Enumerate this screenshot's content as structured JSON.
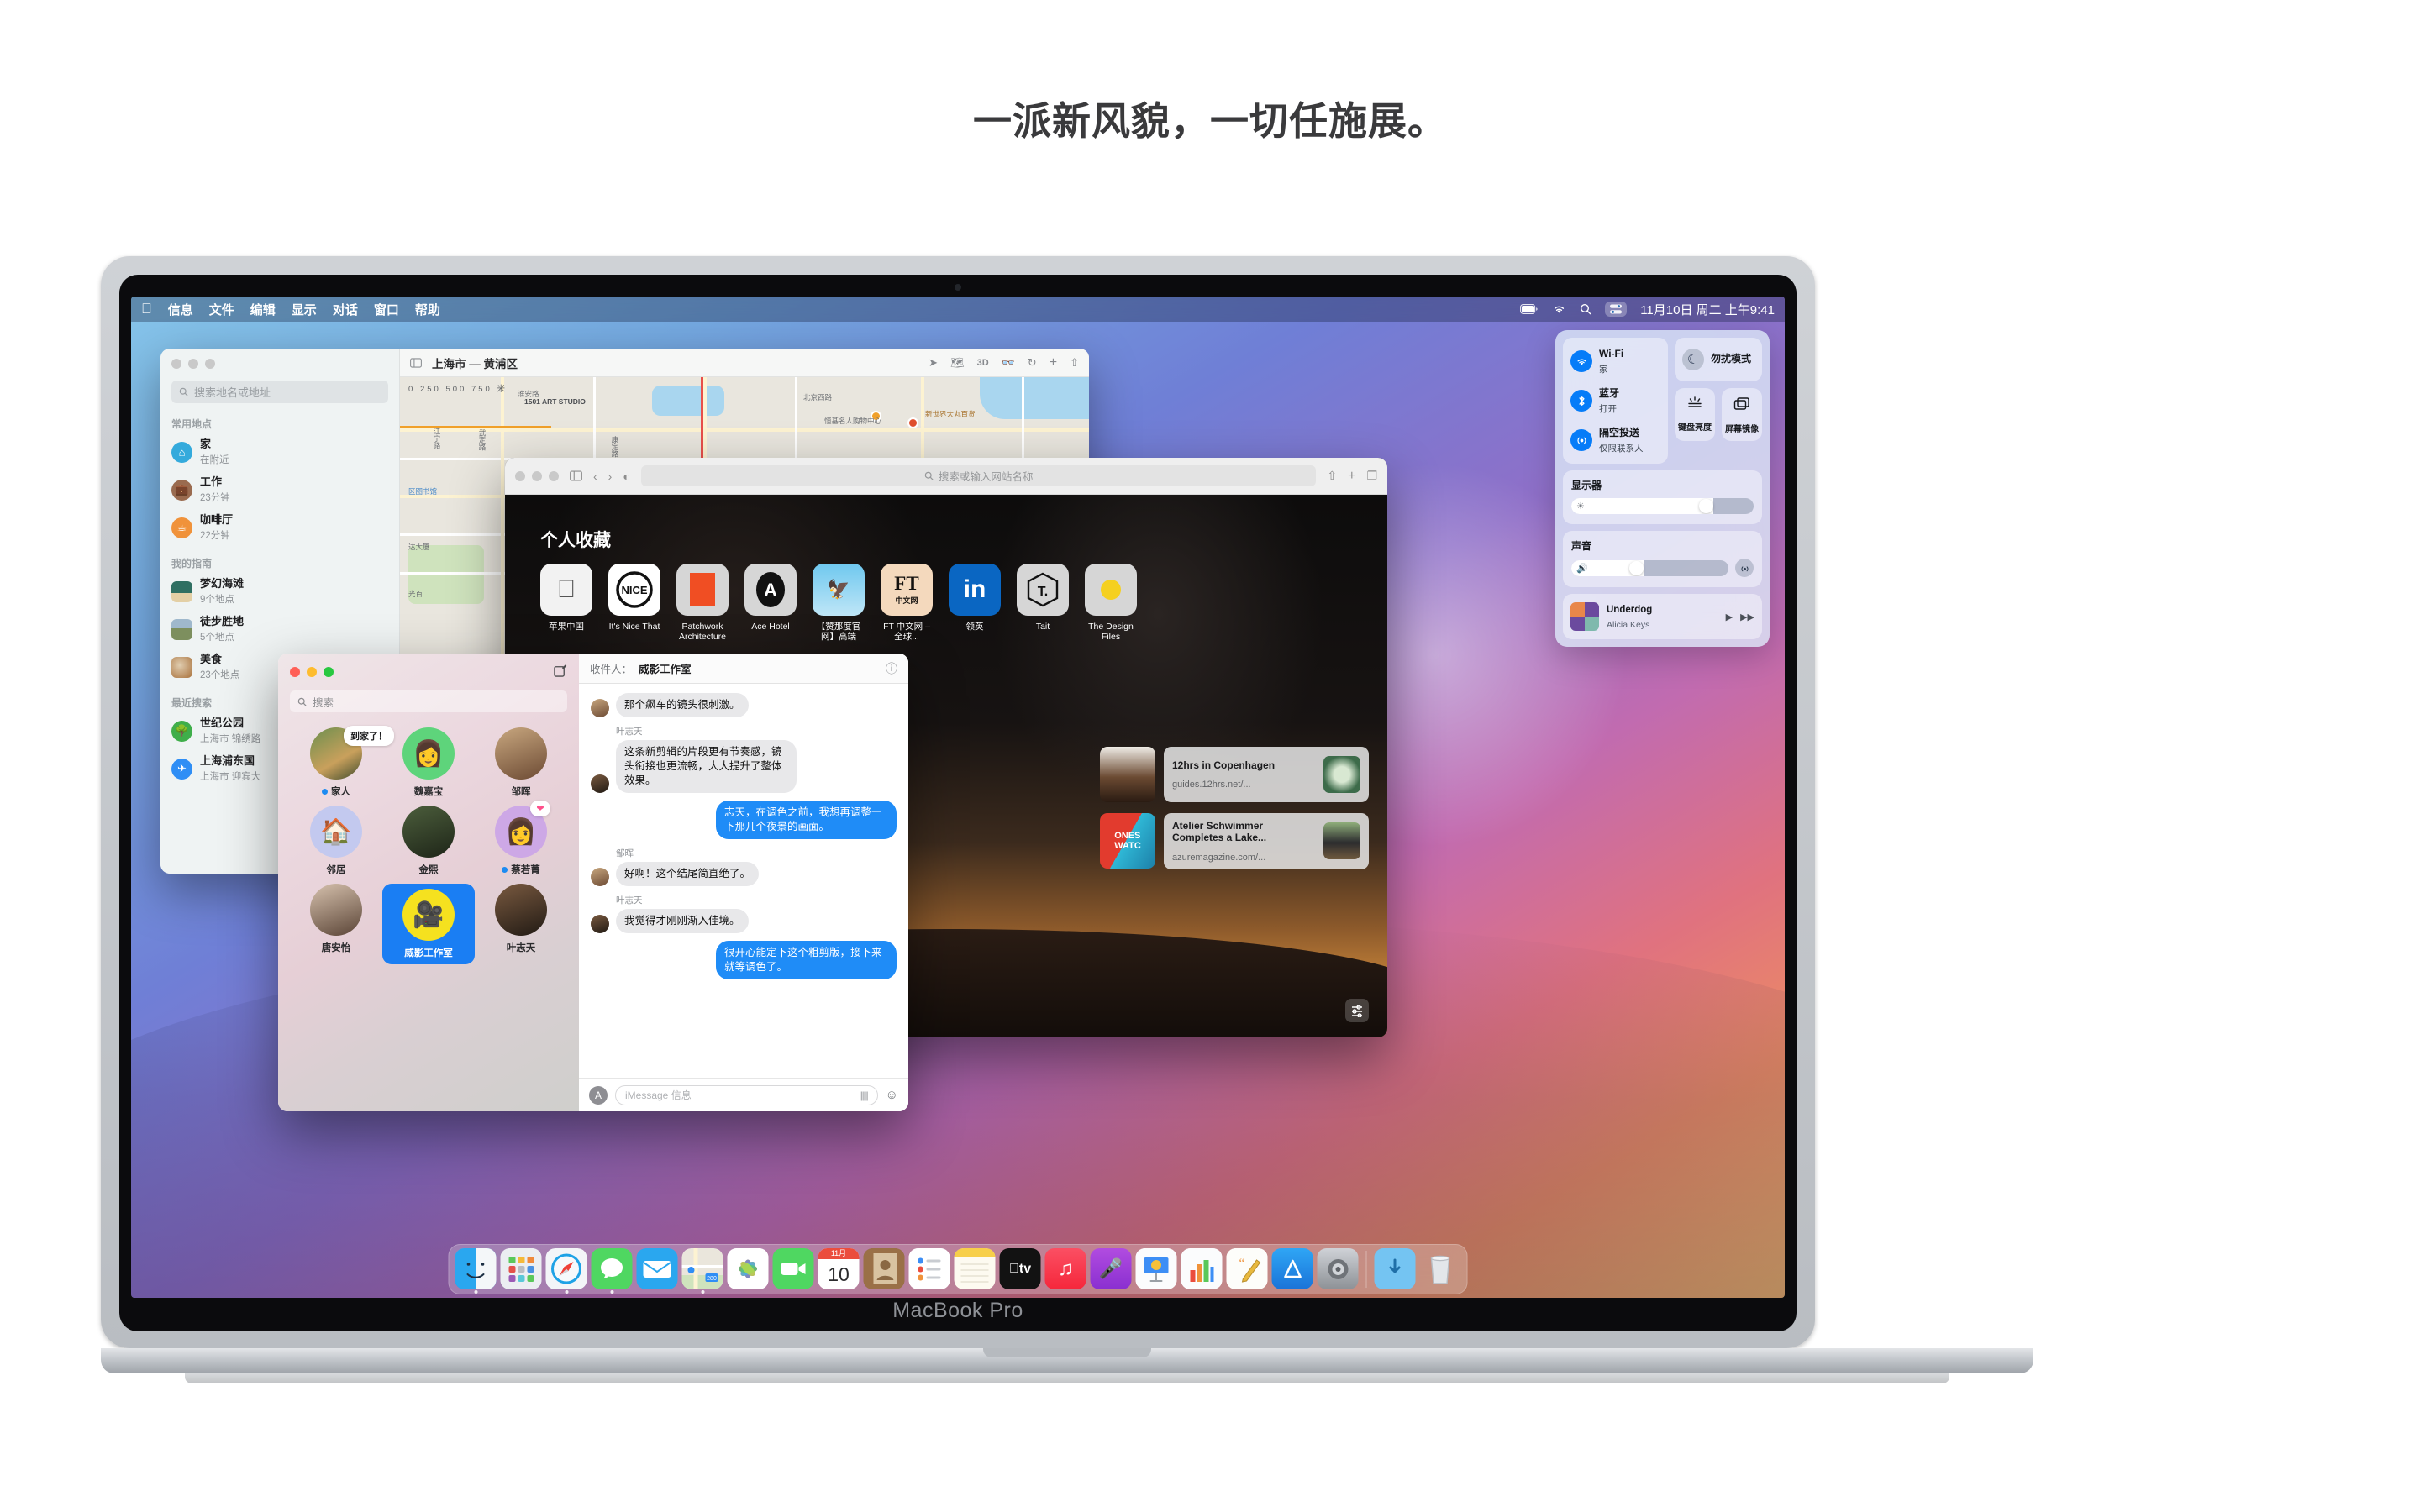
{
  "headline": "一派新风貌，一切任施展。",
  "device": {
    "name": "MacBook Pro"
  },
  "menubar": {
    "apple": "",
    "items": [
      "信息",
      "文件",
      "编辑",
      "显示",
      "对话",
      "窗口",
      "帮助"
    ],
    "clock": "11月10日 周二 上午9:41",
    "status_icons": [
      "battery-icon",
      "wifi-icon",
      "search-icon",
      "control-center-icon"
    ]
  },
  "maps": {
    "search_placeholder": "搜索地名或地址",
    "title": "上海市 — 黄浦区",
    "toolbar_icons": [
      "location-arrow-icon",
      "map-layers-icon",
      "3d-icon",
      "binoculars-icon",
      "share-route-icon",
      "zoom-in-icon",
      "share-icon"
    ],
    "sections": [
      {
        "title": "常用地点",
        "items": [
          {
            "name": "家",
            "detail": "在附近",
            "icon": "home-icon",
            "color": "#34aadc"
          },
          {
            "name": "工作",
            "detail": "23分钟",
            "icon": "briefcase-icon",
            "color": "#9a6b4f"
          },
          {
            "name": "咖啡厅",
            "detail": "22分钟",
            "icon": "coffee-icon",
            "color": "#f0923a"
          }
        ]
      },
      {
        "title": "我的指南",
        "items": [
          {
            "name": "梦幻海滩",
            "detail": "9个地点",
            "icon": "beach-thumb",
            "color": "#2f6f62"
          },
          {
            "name": "徒步胜地",
            "detail": "5个地点",
            "icon": "hiking-thumb",
            "color": "#6b8d5a"
          },
          {
            "name": "美食",
            "detail": "23个地点",
            "icon": "food-thumb",
            "color": "#b4732f"
          }
        ]
      },
      {
        "title": "最近搜索",
        "items": [
          {
            "name": "世纪公园",
            "detail": "上海市 锦绣路",
            "icon": "park-icon",
            "color": "#3fae4a"
          },
          {
            "name": "上海浦东国",
            "detail": "上海市 迎宾大",
            "icon": "airport-icon",
            "color": "#2f8ef5"
          }
        ]
      }
    ],
    "scale_labels": [
      "0",
      "250",
      "500",
      "750",
      "米"
    ],
    "map_labels": [
      "1501 ART STUDIO",
      "淮安路",
      "北京西路",
      "恒基名人购物中心",
      "新世界大丸百货",
      "区图书馆",
      "达大厦",
      "光百",
      "康定路",
      "武定路",
      "江宁路"
    ]
  },
  "safari": {
    "url_placeholder": "搜索或输入网站名称",
    "toolbar_icons": [
      "sidebar-icon",
      "back-icon",
      "forward-icon",
      "privacy-report-icon",
      "share-icon",
      "new-tab-icon",
      "tab-overview-icon"
    ],
    "favorites_title": "个人收藏",
    "favorites": [
      {
        "label": "苹果中国",
        "icon": "apple-logo"
      },
      {
        "label": "It's Nice That",
        "icon": "nice-that-logo"
      },
      {
        "label": "Patchwork Architecture",
        "icon": "patchwork-logo"
      },
      {
        "label": "Ace Hotel",
        "icon": "ace-hotel-logo"
      },
      {
        "label": "【赞那度官网】高端",
        "icon": "zanadu-logo"
      },
      {
        "label": "FT 中文网 – 全球...",
        "icon": "ft-logo"
      },
      {
        "label": "领英",
        "icon": "linkedin-logo"
      },
      {
        "label": "Tait",
        "icon": "tait-logo"
      },
      {
        "label": "The Design Files",
        "icon": "design-files-logo"
      }
    ],
    "reading_list": [
      {
        "title": "12hrs in Copenhagen",
        "url": "guides.12hrs.net/..."
      },
      {
        "title": "Atelier Schwimmer Completes a Lake...",
        "url": "azuremagazine.com/..."
      }
    ]
  },
  "messages": {
    "search_placeholder": "搜索",
    "compose_icon": "compose-icon",
    "contacts": [
      {
        "name": "家人",
        "unread": true,
        "bubble": "到家了！",
        "avatar": "family-photo"
      },
      {
        "name": "魏嘉宝",
        "unread": false,
        "avatar": "memoji-green"
      },
      {
        "name": "邹晖",
        "unread": false,
        "avatar": "woman-photo"
      },
      {
        "name": "邻居",
        "unread": false,
        "avatar": "house-emoji"
      },
      {
        "name": "金熙",
        "unread": false,
        "avatar": "man-glasses-photo"
      },
      {
        "name": "蔡若菁",
        "unread": true,
        "avatar": "memoji-beret",
        "reaction": "♥"
      },
      {
        "name": "唐安怡",
        "unread": false,
        "avatar": "woman-bob-photo"
      },
      {
        "name": "威影工作室",
        "selected": true,
        "avatar": "projector-emoji"
      },
      {
        "name": "叶志天",
        "unread": false,
        "avatar": "man-photo"
      }
    ],
    "recipient_label": "收件人：",
    "recipient": "威影工作室",
    "thread": [
      {
        "from": "them",
        "sender": "",
        "text": "那个飙车的镜头很刺激。",
        "avatar": "woman-photo"
      },
      {
        "from": "them",
        "sender": "叶志天",
        "text": "这条新剪辑的片段更有节奏感，镜头衔接也更流畅，大大提升了整体效果。",
        "avatar": "man-photo"
      },
      {
        "from": "me",
        "sender": "",
        "text": "志天，在调色之前，我想再调整一下那几个夜景的画面。",
        "avatar": ""
      },
      {
        "from": "them",
        "sender": "邹晖",
        "text": "好啊！这个结尾简直绝了。",
        "avatar": "woman-photo"
      },
      {
        "from": "them",
        "sender": "叶志天",
        "text": "我觉得才刚刚渐入佳境。",
        "avatar": "man-photo"
      },
      {
        "from": "me",
        "sender": "",
        "text": "很开心能定下这个粗剪版，接下来就等调色了。",
        "avatar": ""
      }
    ],
    "input_placeholder": "iMessage 信息",
    "input_icons": [
      "app-store-icon",
      "audio-message-icon",
      "emoji-icon"
    ]
  },
  "control_center": {
    "wifi": {
      "title": "Wi-Fi",
      "sub": "家",
      "icon": "wifi-icon",
      "on": true
    },
    "bluetooth": {
      "title": "蓝牙",
      "sub": "打开",
      "icon": "bluetooth-icon",
      "on": true
    },
    "airdrop": {
      "title": "隔空投送",
      "sub": "仅限联系人",
      "icon": "airdrop-icon",
      "on": true
    },
    "dnd": {
      "title": "勿扰模式",
      "icon": "moon-icon",
      "on": false
    },
    "keyboard_brightness": {
      "title": "键盘亮度",
      "icon": "keyboard-brightness-icon"
    },
    "screen_mirroring": {
      "title": "屏幕镜像",
      "icon": "screen-mirroring-icon"
    },
    "display": {
      "title": "显示器",
      "icon": "brightness-icon",
      "value": 78
    },
    "sound": {
      "title": "声音",
      "icon": "speaker-icon",
      "value": 46,
      "airplay_icon": "airplay-icon"
    },
    "now_playing": {
      "title": "Underdog",
      "artist": "Alicia Keys",
      "play_icon": "play-icon",
      "next_icon": "forward-icon"
    }
  },
  "dock": {
    "apps": [
      {
        "name": "访达",
        "icon": "finder-icon",
        "running": true
      },
      {
        "name": "启动台",
        "icon": "launchpad-icon",
        "running": false
      },
      {
        "name": "Safari 浏览器",
        "icon": "safari-icon",
        "running": true
      },
      {
        "name": "信息",
        "icon": "messages-icon",
        "running": true
      },
      {
        "name": "邮件",
        "icon": "mail-icon",
        "running": false
      },
      {
        "name": "地图",
        "icon": "maps-icon",
        "running": true
      },
      {
        "name": "照片",
        "icon": "photos-icon",
        "running": false
      },
      {
        "name": "FaceTime 通话",
        "icon": "facetime-icon",
        "running": false
      },
      {
        "name": "日历",
        "icon": "calendar-icon",
        "running": false,
        "month": "11月",
        "day": "10"
      },
      {
        "name": "通讯录",
        "icon": "contacts-icon",
        "running": false
      },
      {
        "name": "提醒事项",
        "icon": "reminders-icon",
        "running": false
      },
      {
        "name": "备忘录",
        "icon": "notes-icon",
        "running": false
      },
      {
        "name": "Apple TV",
        "icon": "appletv-icon",
        "running": false
      },
      {
        "name": "音乐",
        "icon": "music-icon",
        "running": false
      },
      {
        "name": "播客",
        "icon": "podcasts-icon",
        "running": false
      },
      {
        "name": "Keynote 讲演",
        "icon": "keynote-icon",
        "running": false
      },
      {
        "name": "Numbers 表格",
        "icon": "numbers-icon",
        "running": false
      },
      {
        "name": "Pages 文稿",
        "icon": "pages-icon",
        "running": false
      },
      {
        "name": "App Store",
        "icon": "appstore-icon",
        "running": false
      },
      {
        "name": "系统偏好设置",
        "icon": "system-preferences-icon",
        "running": false
      }
    ],
    "folders": [
      {
        "name": "下载",
        "icon": "downloads-folder-icon"
      },
      {
        "name": "废纸篓",
        "icon": "trash-icon"
      }
    ]
  }
}
